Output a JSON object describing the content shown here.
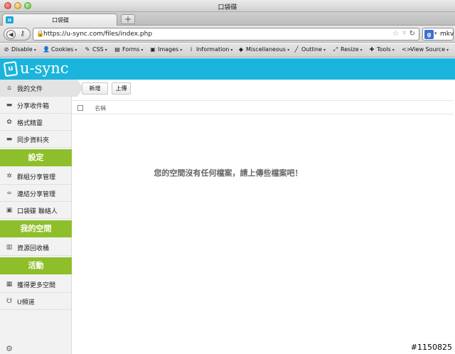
{
  "window": {
    "title": "口袋碟"
  },
  "tab": {
    "title": "口袋碟",
    "favicon": "u",
    "new_tab": "+"
  },
  "nav": {
    "url": "https://u-sync.com/files/index.php",
    "search_text": "mkv",
    "search_engine": "g"
  },
  "devbar": {
    "items": [
      {
        "icon": "disable-icon",
        "glyph": "⊘",
        "label": "Disable"
      },
      {
        "icon": "cookies-icon",
        "glyph": "👤",
        "label": "Cookies"
      },
      {
        "icon": "css-icon",
        "glyph": "✎",
        "label": "CSS"
      },
      {
        "icon": "forms-icon",
        "glyph": "▤",
        "label": "Forms"
      },
      {
        "icon": "images-icon",
        "glyph": "▣",
        "label": "Images"
      },
      {
        "icon": "information-icon",
        "glyph": "i",
        "label": "Information"
      },
      {
        "icon": "miscellaneous-icon",
        "glyph": "◆",
        "label": "Miscellaneous"
      },
      {
        "icon": "outline-icon",
        "glyph": "╱",
        "label": "Outline"
      },
      {
        "icon": "resize-icon",
        "glyph": "⤢",
        "label": "Resize"
      },
      {
        "icon": "tools-icon",
        "glyph": "✚",
        "label": "Tools"
      },
      {
        "icon": "view-source-icon",
        "glyph": "<>",
        "label": "View Source"
      }
    ]
  },
  "app": {
    "logo_text": "u-sync",
    "logo_icon": "u"
  },
  "sidebar": {
    "my_files": "我的文件",
    "share_inbox": "分享收件箱",
    "format_fit": "格式精靈",
    "sync_folder": "同步資料夾",
    "settings_head": "設定",
    "group_share": "群組分享管理",
    "link_share": "連結分享管理",
    "contacts": "口袋碟 聯絡人",
    "my_space_head": "我的空間",
    "recycle_bin": "資源回收桶",
    "activity_head": "活動",
    "more_space": "獲得更多空間",
    "u_channel": "U頻道"
  },
  "main": {
    "new_button": "新增",
    "upload_button": "上傳",
    "name_column": "名稱",
    "empty_message": "您的空間沒有任何檔案，請上傳些檔案吧！"
  },
  "watermark": "#1150825",
  "colors": {
    "header": "#1bb4dc",
    "section": "#8ebf2a"
  }
}
